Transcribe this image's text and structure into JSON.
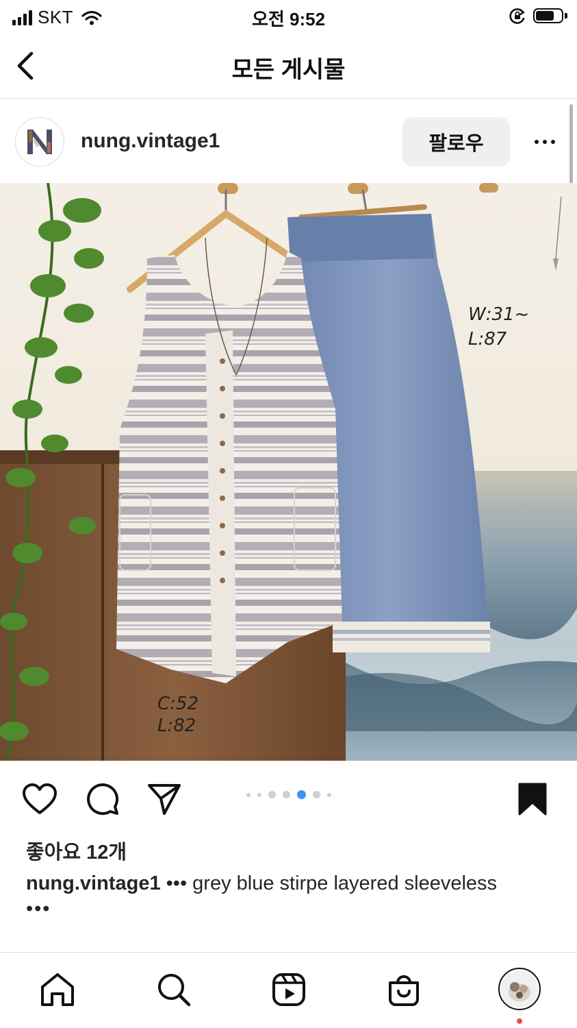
{
  "status_bar": {
    "carrier": "SKT",
    "time": "오전 9:52",
    "icons": [
      "signal-icon",
      "wifi-icon",
      "orientation-lock-icon",
      "battery-icon"
    ],
    "battery_level": 0.75
  },
  "nav": {
    "title": "모든 게시물",
    "back_icon": "chevron-left-icon"
  },
  "post": {
    "username": "nung.vintage1",
    "follow_label": "팔로우",
    "more_icon": "more-horizontal-icon",
    "image": {
      "description_labels": {
        "dress_chest": "C:52",
        "dress_length": "L:82",
        "skirt_waist": "W:31~",
        "skirt_length": "L:87"
      }
    },
    "carousel": {
      "count": 7,
      "active_index": 4
    },
    "likes": "좋아요 12개",
    "caption_user": "nung.vintage1",
    "caption_text": "••• grey blue stirpe layered sleeveless",
    "caption_more": "•••"
  },
  "actions": {
    "icons": [
      "heart-icon",
      "comment-icon",
      "share-icon",
      "bookmark-icon"
    ]
  },
  "tab_bar": {
    "items": [
      "home-icon",
      "search-icon",
      "reels-icon",
      "shop-icon",
      "profile-avatar"
    ]
  },
  "colors": {
    "accent_blue": "#3897f0",
    "notification_red": "#ed4956",
    "divider": "#dbdbdb",
    "follow_bg": "#efefef"
  }
}
